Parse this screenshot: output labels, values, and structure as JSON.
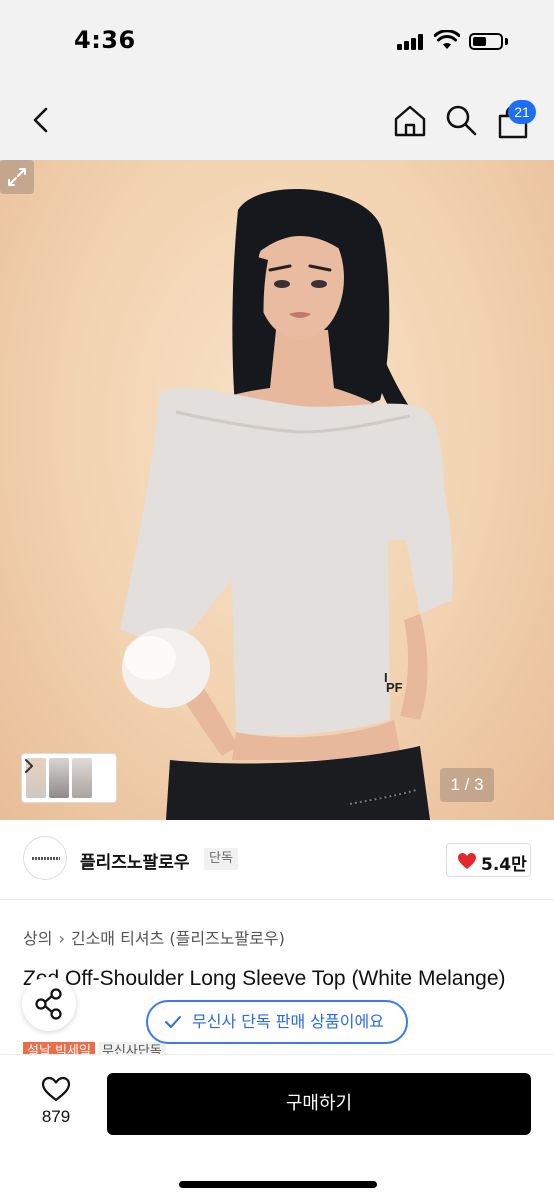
{
  "status_bar": {
    "time": "4:36",
    "battery_level": 0.5
  },
  "nav": {
    "cart_count": "21",
    "badge_color": "#1e6ef5",
    "icons": [
      "back-chevron-icon",
      "home-icon",
      "search-icon",
      "shopping-bag-icon"
    ]
  },
  "gallery": {
    "page_indicator": "1 / 3",
    "icons": [
      "thumbnail-arrow-icon",
      "expand-icon"
    ]
  },
  "brand": {
    "name": "플리즈노팔로우",
    "tag": "단독",
    "likes": "5.4만",
    "heart_color": "#e8262d"
  },
  "product": {
    "breadcrumb": [
      "상의",
      "긴소매 티셔츠 (플리즈노팔로우)"
    ],
    "title": "Zed Off-Shoulder Long Sleeve Top (White Melange)",
    "tags": {
      "sale": "설날 빅세일",
      "exclusive": "무신사단독"
    },
    "sale_color": "#f06b4a"
  },
  "floating": {
    "exclusive_notice": "무신사 단독 판매 상품이에요",
    "accent_color": "#3b7af0",
    "icons": [
      "share-icon",
      "check-icon"
    ]
  },
  "bottom_bar": {
    "wish_count": "879",
    "buy_label": "구매하기"
  }
}
